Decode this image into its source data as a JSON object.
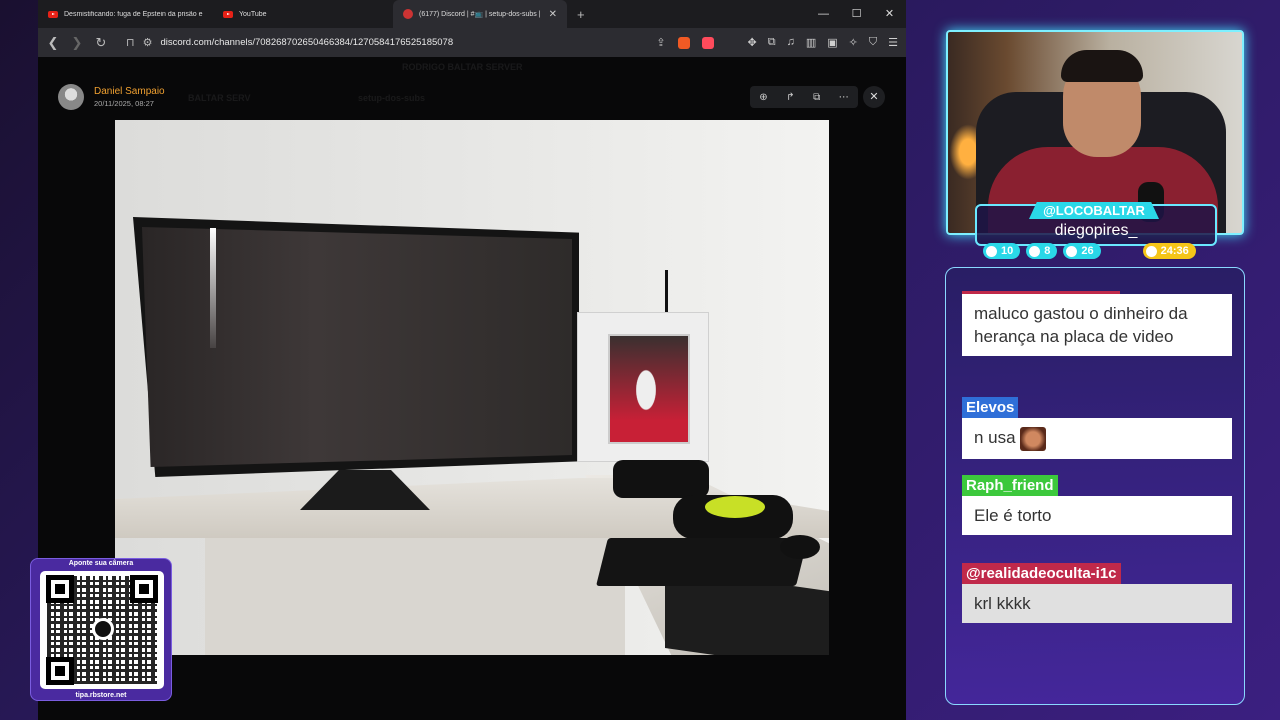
{
  "browser": {
    "tabs": [
      {
        "label": "Desmistificando: fuga de Epstein da prisão e"
      },
      {
        "label": "YouTube"
      },
      {
        "label": "(6177) Discord | #📺 | setup-dos-subs |"
      }
    ],
    "url": "discord.com/channels/708268702650466384/1270584176525185078"
  },
  "viewer": {
    "uploader_name": "Daniel Sampaio",
    "upload_date": "20/11/2025, 08:27",
    "ghost_server": "RODRIGO BALTAR SERVER",
    "ghost_server_short": "BALTAR SERV",
    "ghost_channel": "setup-dos-subs"
  },
  "qr": {
    "title": "Aponte sua câmera",
    "url": "tipa.rbstore.net"
  },
  "streamer": {
    "handle": "@LOCOBALTAR",
    "name": "diegopires_",
    "stats": {
      "twitch": "10",
      "youtube": "8",
      "kick": "26",
      "timer": "24:36"
    }
  },
  "chat": [
    {
      "user": "",
      "text": "maluco gastou o dinheiro da herança na placa de video",
      "color": "#c0294a"
    },
    {
      "user": "Elevos",
      "text": "n usa",
      "color": "#2f6fd8",
      "emote": true
    },
    {
      "user": "Raph_friend",
      "text": "Ele é torto",
      "color": "#3cc83c"
    },
    {
      "user": "@realidadeoculta-i1c",
      "text": "krl kkkk",
      "color": "#c0294a"
    }
  ],
  "colors": {
    "accent": "#2ad8e8",
    "timer": "#f5c518",
    "panel": "#4a2aa0"
  }
}
